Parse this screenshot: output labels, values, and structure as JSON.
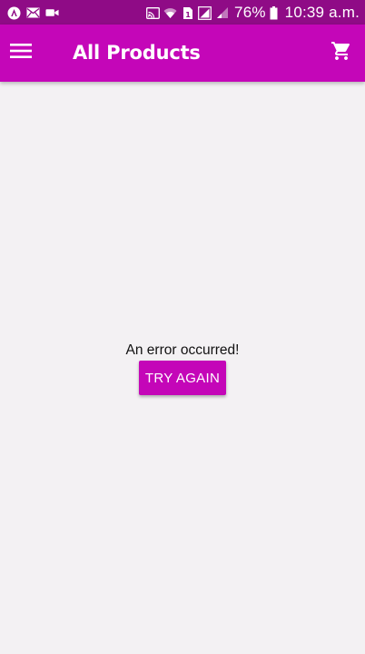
{
  "status_bar": {
    "left_icons": [
      "app-notification-icon",
      "mail-icon",
      "video-icon"
    ],
    "right_icons": [
      "cast-icon",
      "wifi-icon",
      "sim-icon",
      "signal-icon",
      "signal-weak-icon",
      "battery-icon"
    ],
    "battery_percent": "76%",
    "time": "10:39 a.m."
  },
  "app_bar": {
    "title": "All Products",
    "menu_icon": "menu-icon",
    "cart_icon": "shopping-cart-icon"
  },
  "main": {
    "error_message": "An error occurred!",
    "retry_label": "TRY AGAIN"
  },
  "colors": {
    "status_bar": "#8f0b86",
    "app_bar": "#c406b8",
    "accent": "#c406b8",
    "background": "#f3f1f3"
  }
}
